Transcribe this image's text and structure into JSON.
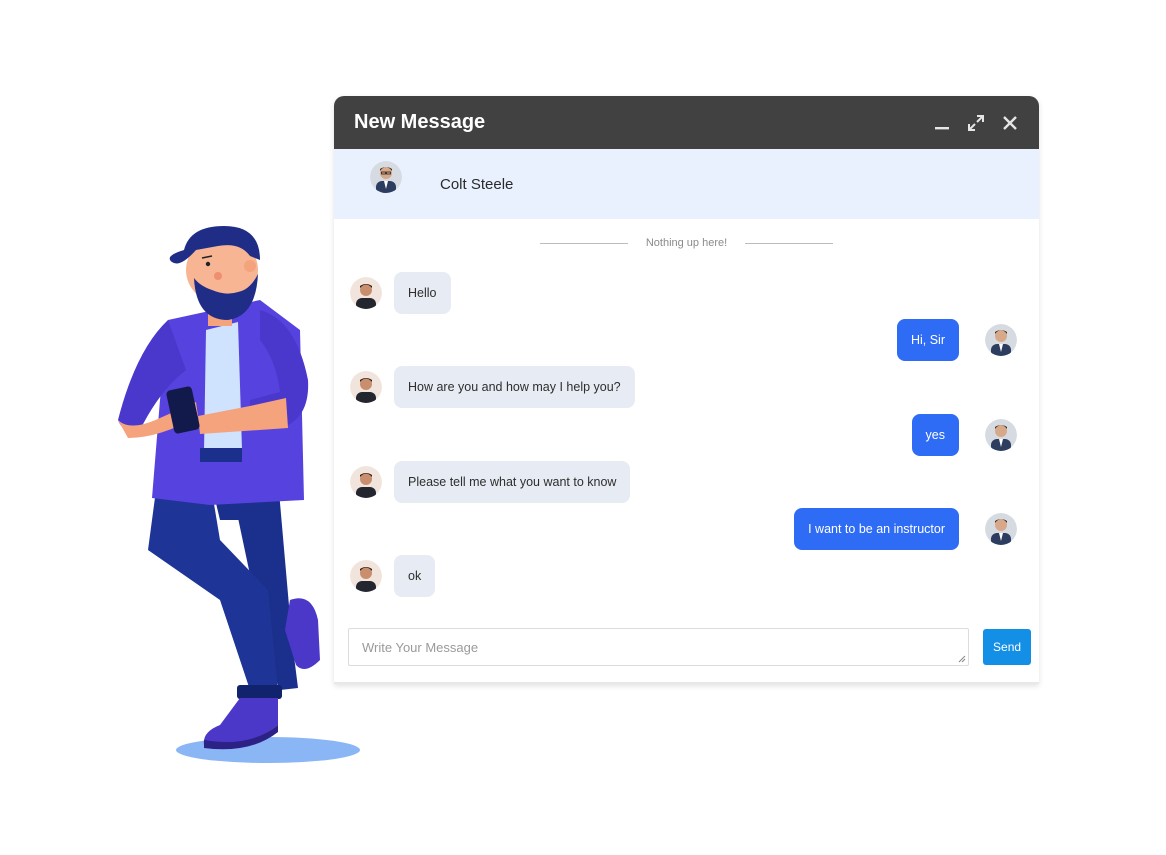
{
  "window": {
    "title": "New Message",
    "controls": [
      "minimize-icon",
      "expand-icon",
      "close-icon"
    ]
  },
  "contact": {
    "name": "Colt Steele"
  },
  "divider_text": "Nothing up here!",
  "messages": [
    {
      "side": "in",
      "text": "Hello"
    },
    {
      "side": "out",
      "text": "Hi, Sir"
    },
    {
      "side": "in",
      "text": "How are you and how may I help you?"
    },
    {
      "side": "out",
      "text": "yes"
    },
    {
      "side": "in",
      "text": "Please tell me what you want to know"
    },
    {
      "side": "out",
      "text": "I want to be an instructor"
    },
    {
      "side": "in",
      "text": "ok"
    }
  ],
  "composer": {
    "placeholder": "Write Your Message",
    "send_label": "Send"
  },
  "colors": {
    "titlebar": "#414141",
    "contact_bar": "#e9f1fe",
    "outgoing": "#2f6cf6",
    "incoming": "#e7ebf3",
    "send": "#148fe6"
  }
}
